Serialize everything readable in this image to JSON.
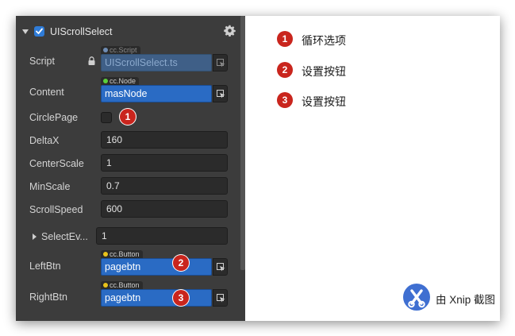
{
  "component": {
    "title": "UIScrollSelect",
    "enabled": true
  },
  "properties": {
    "script": {
      "label": "Script",
      "type_tag": "cc.Script",
      "value": "UIScrollSelect.ts"
    },
    "content": {
      "label": "Content",
      "type_tag": "cc.Node",
      "value": "masNode"
    },
    "circle_page": {
      "label": "CirclePage",
      "checked": false
    },
    "delta_x": {
      "label": "DeltaX",
      "value": "160"
    },
    "center_scale": {
      "label": "CenterScale",
      "value": "1"
    },
    "min_scale": {
      "label": "MinScale",
      "value": "0.7"
    },
    "scroll_speed": {
      "label": "ScrollSpeed",
      "value": "600"
    },
    "select_events": {
      "label": "SelectEv...",
      "value": "1"
    },
    "left_btn": {
      "label": "LeftBtn",
      "type_tag": "cc.Button",
      "value": "pagebtn"
    },
    "right_btn": {
      "label": "RightBtn",
      "type_tag": "cc.Button",
      "value": "pagebtn"
    }
  },
  "badges": [
    "1",
    "2",
    "3"
  ],
  "legend": [
    {
      "number": "1",
      "text": "循环选项"
    },
    {
      "number": "2",
      "text": "设置按钮"
    },
    {
      "number": "3",
      "text": "设置按钮"
    }
  ],
  "watermark": {
    "text": "由 Xnip 截图"
  },
  "colors": {
    "panel_bg": "#3c3c3c",
    "field_bg": "#2b2b2b",
    "object_field": "#2a6bc4",
    "badge_red": "#c9251d",
    "node_dot": "#5ccf3a",
    "button_dot": "#e8c21a",
    "script_dot": "#6f8db5",
    "checkbox_blue": "#2f7cd8",
    "xnip_blue": "#3f6fd1"
  },
  "icons": {
    "collapse": "triangle-down-icon",
    "settings": "gear-icon",
    "lock": "lock-icon",
    "picker": "object-picker-icon",
    "expand": "triangle-right-icon",
    "watermark": "xnip-scissors-icon"
  }
}
